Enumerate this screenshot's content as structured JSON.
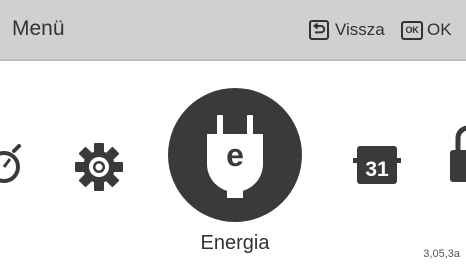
{
  "header": {
    "title": "Menü",
    "back_label": "Vissza",
    "ok_key_label": "OK",
    "ok_label": "OK"
  },
  "carousel": {
    "items": [
      {
        "icon": "stopwatch-icon"
      },
      {
        "icon": "gear-icon"
      },
      {
        "icon": "energy-plug-icon",
        "selected": true,
        "label": "Energia",
        "glyph": "e"
      },
      {
        "icon": "calendar-icon",
        "text": "31"
      },
      {
        "icon": "lock-icon"
      }
    ]
  },
  "selected": {
    "label": "Energia",
    "glyph": "e"
  },
  "calendar": {
    "day": "31"
  },
  "version": "3,05,3a",
  "colors": {
    "header_bg": "#d0d0d0",
    "icon_dark": "#3a3a3a",
    "text": "#333333",
    "background": "#ffffff"
  }
}
